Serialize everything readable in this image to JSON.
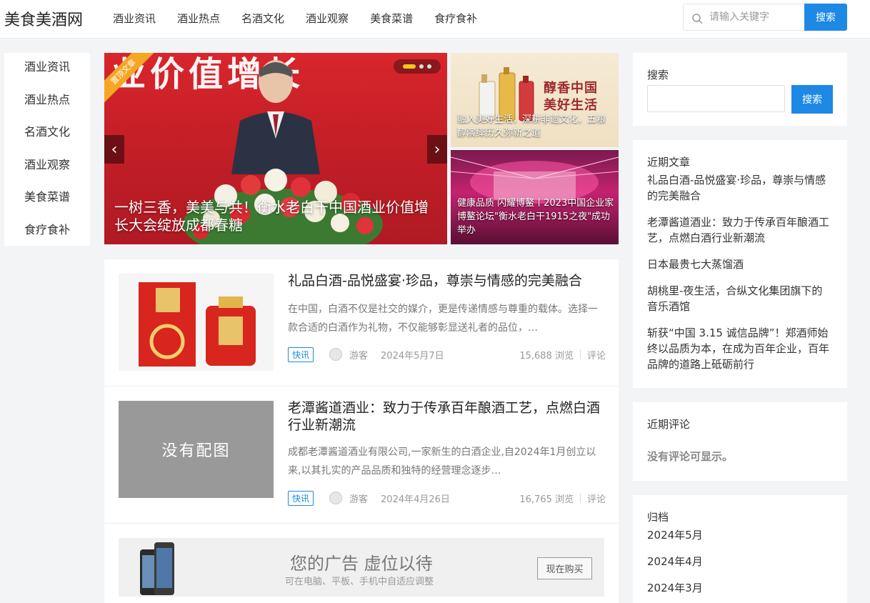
{
  "site": {
    "logo": "美食美酒网"
  },
  "header": {
    "nav": [
      "酒业资讯",
      "酒业热点",
      "名酒文化",
      "酒业观察",
      "美食菜谱",
      "食疗食补"
    ],
    "search_placeholder": "请输入关键字",
    "search_button": "搜索"
  },
  "left_nav": [
    "酒业资讯",
    "酒业热点",
    "名酒文化",
    "酒业观察",
    "美食菜谱",
    "食疗食补"
  ],
  "slider": {
    "ribbon": "置顶文章",
    "background_text": "业价值增长",
    "caption": "一树三香，美美与共！衡水老白干中国酒业价值增长大会绽放成都春糖",
    "prev": "‹",
    "next": "›",
    "active_dot": 0,
    "dot_count": 3
  },
  "side_cards": [
    {
      "caption": "融入美好生活，深耕非遗文化，五粮醇演绎历久弥新之道",
      "image_text": "醇香中国 美好生活"
    },
    {
      "caption": "健康品质 闪耀博鳌丨2023中国企业家博鳌论坛\"衡水老白干1915之夜\"成功举办"
    }
  ],
  "articles": [
    {
      "title": "礼品白酒-品悦盛宴·珍品，尊崇与情感的完美融合",
      "excerpt": "在中国，白酒不仅是社交的媒介，更是传递情感与尊重的载体。选择一款合适的白酒作为礼物，不仅能够彰显送礼者的品位，…",
      "tag": "快讯",
      "author": "游客",
      "date": "2024年5月7日",
      "views": "15,688 浏览",
      "comments": "评论"
    },
    {
      "title": "老潭酱道酒业：致力于传承百年酿酒工艺，点燃白酒行业新潮流",
      "excerpt": "成都老潭酱道酒业有限公司,一家新生的白酒企业,自2024年1月创立以来,以其扎实的产品品质和独特的经营理念逐步…",
      "thumb_text": "没有配图",
      "tag": "快讯",
      "author": "游客",
      "date": "2024年4月26日",
      "views": "16,765 浏览",
      "comments": "评论"
    }
  ],
  "ad": {
    "headline": "您的广告 虚位以待",
    "sub": "可在电脑、平板、手机中自适应调整",
    "button": "现在购买"
  },
  "sidebar": {
    "search_title": "搜索",
    "search_button": "搜索",
    "recent_title": "近期文章",
    "recent_posts": [
      "礼品白酒-品悦盛宴·珍品，尊崇与情感的完美融合",
      "老潭酱道酒业：致力于传承百年酿酒工艺，点燃白酒行业新潮流",
      "日本最贵七大蒸馏酒",
      "胡桃里-夜生活，合纵文化集团旗下的音乐酒馆",
      "斩获“中国 3.15 诚信品牌”！郑酒师始终以品质为本，在成为百年企业，百年品牌的道路上砥砺前行"
    ],
    "comments_title": "近期评论",
    "comments_empty": "没有评论可显示。",
    "archive_title": "归档",
    "archives": [
      "2024年5月",
      "2024年4月",
      "2024年3月"
    ]
  },
  "colors": {
    "accent": "#1e88e5",
    "ribbon": "#f5a623",
    "slider_bg": "#c71f27"
  }
}
